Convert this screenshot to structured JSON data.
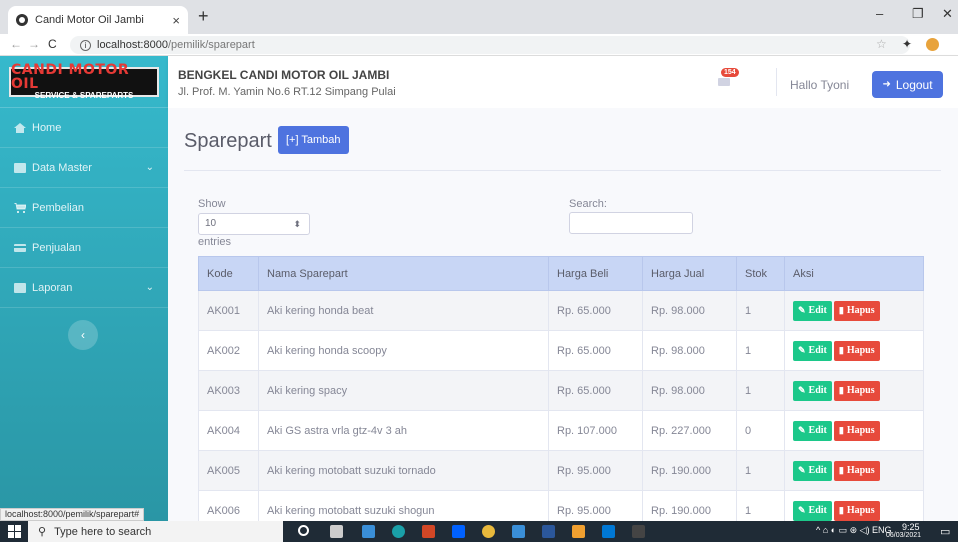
{
  "browser": {
    "tab_title": "Candi Motor Oil Jambi",
    "tab_close": "×",
    "new_tab": "+",
    "url_host": "localhost:8000",
    "url_path": "/pemilik/sparepart",
    "status_url": "localhost:8000/pemilik/sparepart#",
    "win_min": "–",
    "win_max": "❐",
    "win_close": "✕"
  },
  "brand": {
    "logo_main": "CANDI MOTOR OIL",
    "logo_sub": "SERVICE & SPAREPARTS"
  },
  "sidebar": {
    "items": [
      {
        "label": "Home",
        "icon": "home-icon"
      },
      {
        "label": "Data Master",
        "icon": "folder-icon",
        "chevron": "⌄"
      },
      {
        "label": "Pembelian",
        "icon": "cart-icon"
      },
      {
        "label": "Penjualan",
        "icon": "card-icon"
      },
      {
        "label": "Laporan",
        "icon": "report-icon",
        "chevron": "⌄"
      }
    ],
    "toggle": "‹"
  },
  "topbar": {
    "shop_name": "BENGKEL CANDI MOTOR OIL JAMBI",
    "shop_address": "Jl. Prof. M. Yamin No.6 RT.12 Simpang Pulai",
    "notif_count": "154",
    "greeting": "Hallo Tyoni",
    "logout_label": "Logout"
  },
  "page": {
    "title": "Sparepart",
    "add_label": "[+] Tambah",
    "show_label": "Show",
    "entries_value": "10",
    "entries_label": "entries",
    "search_label": "Search:",
    "search_value": ""
  },
  "table": {
    "headers": [
      "Kode",
      "Nama Sparepart",
      "Harga Beli",
      "Harga Jual",
      "Stok",
      "Aksi"
    ],
    "edit_label": "Edit",
    "delete_label": "Hapus",
    "rows": [
      [
        "AK001",
        "Aki kering honda beat",
        "Rp. 65.000",
        "Rp. 98.000",
        "1"
      ],
      [
        "AK002",
        "Aki kering honda scoopy",
        "Rp. 65.000",
        "Rp. 98.000",
        "1"
      ],
      [
        "AK003",
        "Aki kering spacy",
        "Rp. 65.000",
        "Rp. 98.000",
        "1"
      ],
      [
        "AK004",
        "Aki GS astra vrla gtz-4v 3 ah",
        "Rp. 107.000",
        "Rp. 227.000",
        "0"
      ],
      [
        "AK005",
        "Aki kering motobatt suzuki tornado",
        "Rp. 95.000",
        "Rp. 190.000",
        "1"
      ],
      [
        "AK006",
        "Aki kering motobatt suzuki shogun",
        "Rp. 95.000",
        "Rp. 190.000",
        "1"
      ]
    ]
  },
  "taskbar": {
    "search_placeholder": "Type here to search",
    "lang": "ENG",
    "time": "9:25",
    "date": "06/03/2021"
  },
  "colors": {
    "sidebar": "#36b9cc",
    "primary": "#4e73df",
    "success": "#1cc88a",
    "danger": "#e74a3b"
  }
}
